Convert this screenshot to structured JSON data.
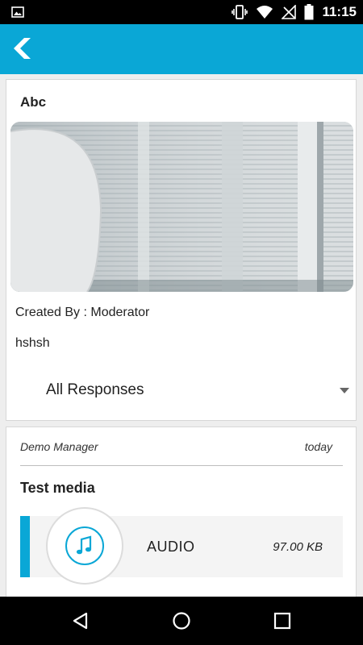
{
  "status_bar": {
    "time": "11:15"
  },
  "post": {
    "title": "Abc",
    "created_by": "Created By : Moderator",
    "description": "hshsh",
    "filter": {
      "selected": "All Responses"
    }
  },
  "response": {
    "author": "Demo Manager",
    "time": "today",
    "title": "Test media",
    "attachment": {
      "type": "AUDIO",
      "size": "97.00 KB"
    }
  },
  "colors": {
    "accent": "#0aa7d6"
  }
}
